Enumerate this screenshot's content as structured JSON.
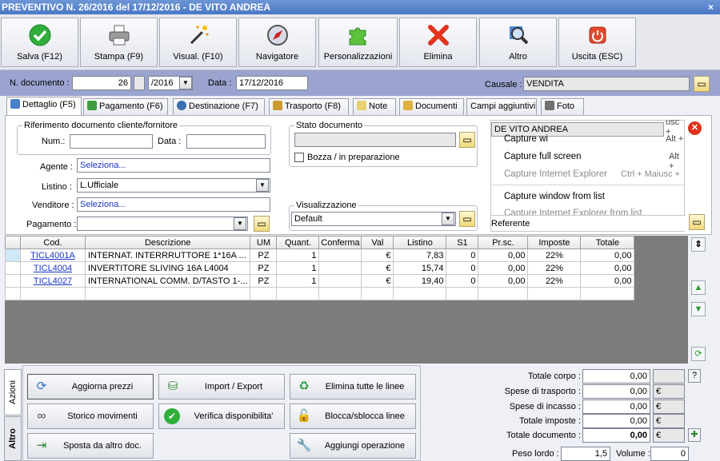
{
  "window": {
    "title": "PREVENTIVO N. 26/2016 del 17/12/2016 - DE VITO ANDREA",
    "close": "×"
  },
  "toolbar": [
    {
      "label": "Salva (F12)",
      "icon": "save-check-icon"
    },
    {
      "label": "Stampa (F9)",
      "icon": "printer-icon"
    },
    {
      "label": "Visual. (F10)",
      "icon": "magic-wand-icon"
    },
    {
      "label": "Navigatore",
      "icon": "compass-icon"
    },
    {
      "label": "Personalizzazioni",
      "icon": "puzzle-icon"
    },
    {
      "label": "Elimina",
      "icon": "delete-x-icon"
    },
    {
      "label": "Altro",
      "icon": "magnifier-icon"
    },
    {
      "label": "Uscita (ESC)",
      "icon": "power-icon"
    }
  ],
  "doc": {
    "num_label": "N. documento :",
    "num_value": "26",
    "year_value": "/2016",
    "date_label": "Data :",
    "date_value": "17/12/2016",
    "causale_label": "Causale :",
    "causale_value": "VENDITA"
  },
  "tabs": [
    {
      "label": "Dettaglio (F5)",
      "color": "#4a7fc9"
    },
    {
      "label": "Pagamento (F6)",
      "color": "#3f9d3f"
    },
    {
      "label": "Destinazione (F7)",
      "color": "#3a6fb0"
    },
    {
      "label": "Trasporto (F8)",
      "color": "#c89a30"
    },
    {
      "label": "Note",
      "color": "#e8d070"
    },
    {
      "label": "Documenti",
      "color": "#e0b040"
    },
    {
      "label": "Campi aggiuntivi",
      "color": ""
    },
    {
      "label": "Foto",
      "color": "#707070"
    }
  ],
  "details": {
    "rif_title": "Riferimento documento cliente/fornitore",
    "num_label": "Num.:",
    "data_label": "Data :",
    "agente_label": "Agente :",
    "agente_value": "Seleziona...",
    "listino_label": "Listino :",
    "listino_value": "L.Ufficiale",
    "venditore_label": "Venditore :",
    "venditore_value": "Seleziona...",
    "pagamento_label": "Pagamento :",
    "stato_title": "Stato documento",
    "bozza_label": "Bozza / in preparazione",
    "visual_title": "Visualizzazione",
    "visual_value": "Default",
    "customer_value": "DE VITO ANDREA",
    "referente_label": "Referente"
  },
  "context_menu": {
    "items": [
      {
        "label": "Capture wi",
        "shortcut": "Alt +",
        "disabled": false
      },
      {
        "label": "Capture full screen",
        "shortcut": "Alt +",
        "disabled": false
      },
      {
        "label": "Capture Internet Explorer",
        "shortcut": "Ctrl + Maiusc +",
        "disabled": true
      },
      {
        "label": "Capture window from list",
        "shortcut": "",
        "disabled": false
      },
      {
        "label": "Capture Internet Explorer from list",
        "shortcut": "",
        "disabled": true
      }
    ],
    "top_fragment": "usc +"
  },
  "grid": {
    "headers": [
      "",
      "Cod.",
      "Descrizione",
      "UM",
      "Quant.",
      "Conferma",
      "Val",
      "Listino",
      "S1",
      "Pr.sc.",
      "Imposte",
      "Totale"
    ],
    "rows": [
      [
        "",
        "TICL4001A",
        "INTERNAT. INTERRRUTTORE 1*16A ...",
        "PZ",
        "1",
        "",
        "€",
        "7,83",
        "0",
        "0,00",
        "22%",
        "0,00"
      ],
      [
        "",
        "TICL4004",
        "INVERTITORE SLIVING 16A L4004",
        "PZ",
        "1",
        "",
        "€",
        "15,74",
        "0",
        "0,00",
        "22%",
        "0,00"
      ],
      [
        "",
        "TICL4027",
        "INTERNATIONAL COMM. D/TASTO 1-...",
        "PZ",
        "1",
        "",
        "€",
        "19,40",
        "0",
        "0,00",
        "22%",
        "0,00"
      ],
      [
        "",
        "",
        "",
        "",
        "",
        "",
        "",
        "",
        "",
        "",
        "",
        ""
      ]
    ]
  },
  "side_tabs": {
    "azioni": "Azioni",
    "altro": "Altro"
  },
  "actions": [
    {
      "label": "Aggiorna prezzi",
      "icon": "refresh-icon",
      "glyph": "⟳"
    },
    {
      "label": "Import / Export",
      "icon": "database-icon",
      "glyph": "⛁"
    },
    {
      "label": "Elimina tutte le linee",
      "icon": "recycle-bin-icon",
      "glyph": "♻"
    },
    {
      "label": "Storico movimenti",
      "icon": "binoculars-icon",
      "glyph": "∞"
    },
    {
      "label": "Verifica disponibilita'",
      "icon": "check-circle-icon",
      "glyph": "✔"
    },
    {
      "label": "Blocca/sblocca linee",
      "icon": "padlock-icon",
      "glyph": "🔓"
    },
    {
      "label": "Sposta da altro doc.",
      "icon": "move-doc-icon",
      "glyph": "⇥"
    },
    {
      "label": "Aggiungi operazione",
      "icon": "wrench-icon",
      "glyph": "🔧"
    }
  ],
  "totals": [
    {
      "label": "Totale corpo :",
      "value": "0,00",
      "unit": ""
    },
    {
      "label": "Spese di trasporto :",
      "value": "0,00",
      "unit": "€"
    },
    {
      "label": "Spese di incasso :",
      "value": "0,00",
      "unit": "€"
    },
    {
      "label": "Totale imposte :",
      "value": "0,00",
      "unit": "€"
    },
    {
      "label": "Totale documento :",
      "value": "0,00",
      "unit": "€"
    }
  ],
  "weights": {
    "peso_label": "Peso lordo :",
    "peso_value": "1,5",
    "volume_label": "Volume :",
    "volume_value": "0"
  },
  "help_button": "?"
}
